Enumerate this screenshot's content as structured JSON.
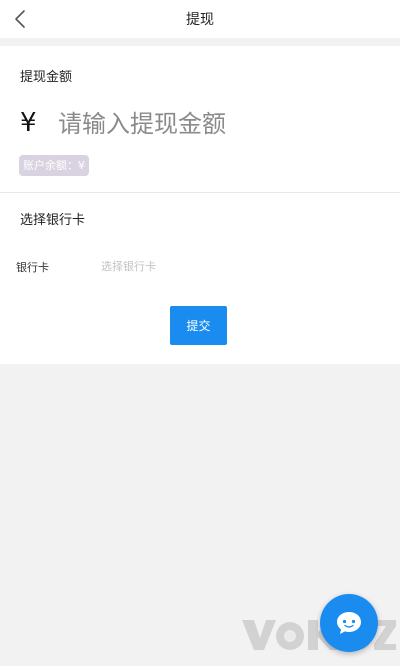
{
  "nav": {
    "title": "提现",
    "back_icon": "chevron-left-icon"
  },
  "withdraw": {
    "amount_label": "提现金额",
    "currency_symbol": "¥",
    "amount_placeholder": "请输入提现金额",
    "amount_value": "",
    "balance_text": "账户余额：¥"
  },
  "bank": {
    "section_label": "选择银行卡",
    "row_label": "银行卡",
    "select_placeholder": "选择银行卡"
  },
  "actions": {
    "submit_label": "提交"
  },
  "floating": {
    "chat_icon": "chat-bubble-icon"
  },
  "watermark": {
    "text": "YOKO.com"
  },
  "colors": {
    "accent": "#1a8cf0",
    "badge_bg": "#d9d2e0",
    "page_bg": "#f2f2f2"
  }
}
